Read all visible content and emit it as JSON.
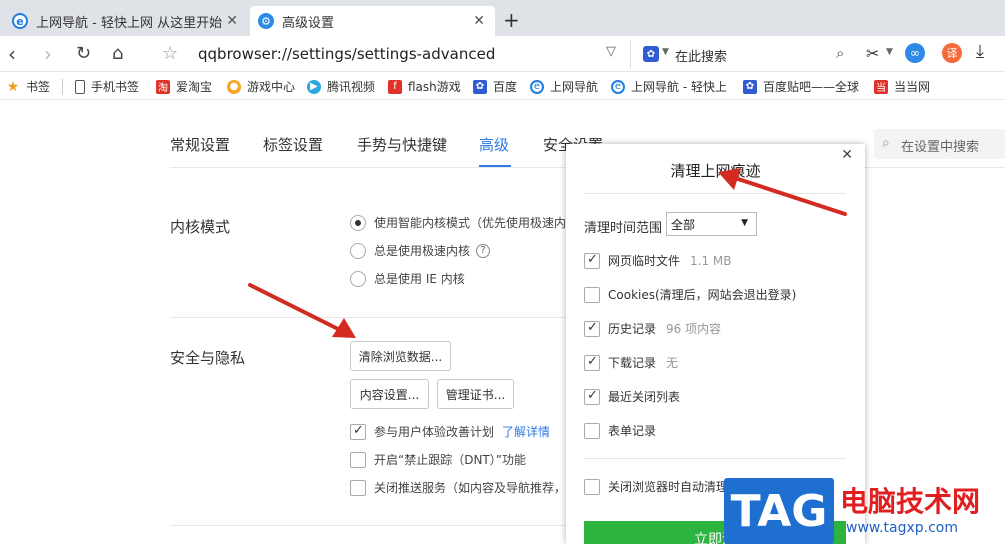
{
  "tabs": [
    {
      "label": "上网导航 - 轻快上网 从这里开始",
      "icon": "ie-icon"
    },
    {
      "label": "高级设置",
      "icon": "gear-icon"
    }
  ],
  "address": {
    "url": "qqbrowser://settings/settings-advanced",
    "search_placeholder": "在此搜索"
  },
  "bookmarks": [
    "书签",
    "手机书签",
    "爱淘宝",
    "游戏中心",
    "腾讯视频",
    "flash游戏",
    "百度",
    "上网导航",
    "上网导航 - 轻快上",
    "百度贴吧——全球",
    "当当网"
  ],
  "settings_tabs": [
    "常规设置",
    "标签设置",
    "手势与快捷键",
    "高级",
    "安全设置"
  ],
  "settings_search_placeholder": "在设置中搜索",
  "kernel": {
    "title": "内核模式",
    "options": [
      "使用智能内核模式（优先使用极速内",
      "总是使用极速内核",
      "总是使用 IE 内核"
    ]
  },
  "privacy": {
    "title": "安全与隐私",
    "clear_button": "清除浏览数据...",
    "content_button": "内容设置...",
    "cert_button": "管理证书...",
    "checks": [
      {
        "label": "参与用户体验改善计划",
        "checked": true,
        "link": "了解详情"
      },
      {
        "label": "开启“禁止跟踪（DNT）”功能",
        "checked": false
      },
      {
        "label": "关闭推送服务（如内容及导航推荐，",
        "checked": false
      }
    ]
  },
  "dialog": {
    "title": "清理上网痕迹",
    "range_label": "清理时间范围",
    "range_value": "全部",
    "items": [
      {
        "label": "网页临时文件",
        "extra": "1.1 MB",
        "checked": true
      },
      {
        "label": "Cookies(清理后，网站会退出登录)",
        "extra": "",
        "checked": false
      },
      {
        "label": "历史记录",
        "extra": "96 项内容",
        "checked": true
      },
      {
        "label": "下载记录",
        "extra": "无",
        "checked": true
      },
      {
        "label": "最近关闭列表",
        "extra": "",
        "checked": true
      },
      {
        "label": "表单记录",
        "extra": "",
        "checked": false
      }
    ],
    "auto_clean": "关闭浏览器时自动清理",
    "button": "立即清"
  },
  "watermark": {
    "tag": "TAG",
    "name": "电脑技术网",
    "url": "www.tagxp.com"
  },
  "colors": {
    "accent": "#2f7be0",
    "arrow": "#d42a1f",
    "green": "#2db33f"
  }
}
